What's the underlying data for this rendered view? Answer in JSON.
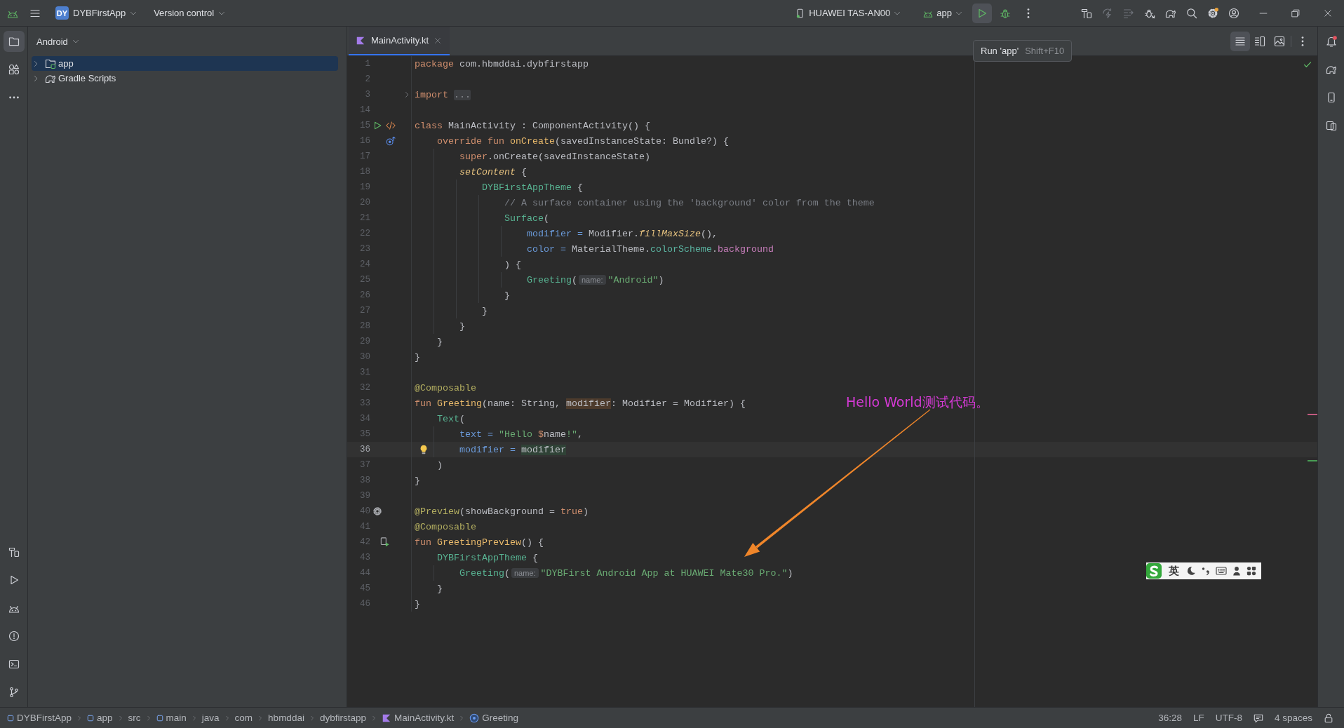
{
  "title_bar": {
    "project_badge": "DY",
    "project": "DYBFirstApp",
    "vcs": "Version control",
    "device": "HUAWEI TAS-AN00",
    "run_config": "app",
    "run_actions": [
      {
        "kind": "run",
        "hovered": true
      },
      {
        "kind": "debug",
        "hovered": false
      },
      {
        "kind": "more",
        "hovered": false
      }
    ],
    "tools": [
      {
        "kind": "make",
        "disabled": false,
        "badge": false
      },
      {
        "kind": "apply_changes",
        "disabled": true,
        "badge": false
      },
      {
        "kind": "apply_code_changes",
        "disabled": true,
        "badge": false
      },
      {
        "kind": "attach_debugger",
        "disabled": false,
        "badge": false
      },
      {
        "kind": "sync",
        "disabled": false,
        "badge": false
      },
      {
        "kind": "search",
        "disabled": false,
        "badge": false
      },
      {
        "kind": "settings",
        "disabled": false,
        "badge": true
      },
      {
        "kind": "account",
        "disabled": false,
        "badge": false
      }
    ],
    "window_controls": [
      {
        "kind": "minimize"
      },
      {
        "kind": "restore"
      },
      {
        "kind": "close"
      }
    ]
  },
  "tooltip": {
    "action": "Run 'app'",
    "shortcut": "Shift+F10"
  },
  "left_strip": {
    "top": [
      {
        "kind": "project",
        "selected": true
      },
      {
        "kind": "structure",
        "selected": false
      },
      {
        "kind": "more",
        "selected": false
      }
    ],
    "bottom": [
      {
        "kind": "build",
        "selected": false
      },
      {
        "kind": "run",
        "selected": false
      },
      {
        "kind": "app_quality",
        "selected": false
      },
      {
        "kind": "problems",
        "selected": false
      },
      {
        "kind": "terminal",
        "selected": false
      },
      {
        "kind": "git",
        "selected": false
      }
    ]
  },
  "project_panel": {
    "view": "Android",
    "tree": [
      {
        "label": "app",
        "kind": "module",
        "selected": true,
        "expanded": false
      },
      {
        "label": "Gradle Scripts",
        "kind": "gradle",
        "selected": false,
        "expanded": false
      }
    ]
  },
  "editor": {
    "tabs": [
      {
        "label": "MainActivity.kt",
        "kind": "kotlin",
        "selected": true
      }
    ],
    "view_modes": [
      {
        "kind": "code",
        "selected": true
      },
      {
        "kind": "split",
        "selected": false
      },
      {
        "kind": "design",
        "selected": false
      }
    ],
    "lines": [
      {
        "number": "1",
        "current": false,
        "tokens": [
          {
            "kind": "keyword",
            "text": "package"
          },
          {
            "kind": "plain",
            "text": " com.hbmddai.dybfirstapp"
          }
        ]
      },
      {
        "number": "2",
        "current": false
      },
      {
        "number": "3",
        "current": false,
        "markers": [
          {
            "kind": "fold"
          }
        ],
        "tokens": [
          {
            "kind": "keyword",
            "text": "import "
          },
          {
            "kind": "folded",
            "text": "..."
          }
        ]
      },
      {
        "number": "14",
        "current": false
      },
      {
        "number": "15",
        "current": false,
        "markers": [
          {
            "kind": "run"
          },
          {
            "kind": "compose"
          }
        ],
        "tokens": [
          {
            "kind": "keyword",
            "text": "class"
          },
          {
            "kind": "plain",
            "text": " MainActivity : ComponentActivity() {"
          }
        ]
      },
      {
        "number": "16",
        "current": false,
        "markers": [
          {
            "kind": "override"
          }
        ],
        "tokens": [
          {
            "kind": "keyword",
            "text": "    override fun "
          },
          {
            "kind": "declaration",
            "text": "onCreate"
          },
          {
            "kind": "plain",
            "text": "(savedInstanceState: Bundle?) {"
          }
        ]
      },
      {
        "number": "17",
        "current": false,
        "tokens": [
          {
            "kind": "keyword",
            "text": "        super"
          },
          {
            "kind": "plain",
            "text": ".onCreate(savedInstanceState)"
          }
        ]
      },
      {
        "number": "18",
        "current": false,
        "tokens": [
          {
            "kind": "extension",
            "text": "        setContent"
          },
          {
            "kind": "plain",
            "text": " {"
          }
        ]
      },
      {
        "number": "19",
        "current": false,
        "tokens": [
          {
            "kind": "composable",
            "text": "            DYBFirstAppTheme"
          },
          {
            "kind": "plain",
            "text": " {"
          }
        ]
      },
      {
        "number": "20",
        "current": false,
        "tokens": [
          {
            "kind": "comment",
            "text": "                // A surface container using the 'background' color from the theme"
          }
        ]
      },
      {
        "number": "21",
        "current": false,
        "tokens": [
          {
            "kind": "composable",
            "text": "                Surface"
          },
          {
            "kind": "plain",
            "text": "("
          }
        ]
      },
      {
        "number": "22",
        "current": false,
        "tokens": [
          {
            "kind": "named_arg",
            "text": "                    modifier ="
          },
          {
            "kind": "plain",
            "text": " Modifier."
          },
          {
            "kind": "extension",
            "text": "fillMaxSize"
          },
          {
            "kind": "plain",
            "text": "(),"
          }
        ]
      },
      {
        "number": "23",
        "current": false,
        "tokens": [
          {
            "kind": "named_arg",
            "text": "                    color ="
          },
          {
            "kind": "plain",
            "text": " MaterialTheme."
          },
          {
            "kind": "property",
            "text": "colorScheme"
          },
          {
            "kind": "plain",
            "text": "."
          },
          {
            "kind": "member",
            "text": "background"
          }
        ]
      },
      {
        "number": "24",
        "current": false,
        "tokens": [
          {
            "kind": "plain",
            "text": "                ) {"
          }
        ]
      },
      {
        "number": "25",
        "current": false,
        "tokens": [
          {
            "kind": "composable",
            "text": "                    Greeting"
          },
          {
            "kind": "plain",
            "text": "("
          },
          {
            "kind": "hint",
            "text": "name:"
          },
          {
            "kind": "string",
            "text": "\"Android\""
          },
          {
            "kind": "plain",
            "text": ")"
          }
        ]
      },
      {
        "number": "26",
        "current": false,
        "tokens": [
          {
            "kind": "plain",
            "text": "                }"
          }
        ]
      },
      {
        "number": "27",
        "current": false,
        "tokens": [
          {
            "kind": "plain",
            "text": "            }"
          }
        ]
      },
      {
        "number": "28",
        "current": false,
        "tokens": [
          {
            "kind": "plain",
            "text": "        }"
          }
        ]
      },
      {
        "number": "29",
        "current": false,
        "tokens": [
          {
            "kind": "plain",
            "text": "    }"
          }
        ]
      },
      {
        "number": "30",
        "current": false,
        "tokens": [
          {
            "kind": "plain",
            "text": "}"
          }
        ]
      },
      {
        "number": "31",
        "current": false
      },
      {
        "number": "32",
        "current": false,
        "tokens": [
          {
            "kind": "annotation",
            "text": "@Composable"
          }
        ]
      },
      {
        "number": "33",
        "current": false,
        "tokens": [
          {
            "kind": "keyword",
            "text": "fun "
          },
          {
            "kind": "declaration",
            "text": "Greeting"
          },
          {
            "kind": "plain",
            "text": "(name: String, "
          },
          {
            "kind": "write_usage",
            "text": "modifier"
          },
          {
            "kind": "plain",
            "text": ": Modifier = Modifier) {"
          }
        ]
      },
      {
        "number": "34",
        "current": false,
        "tokens": [
          {
            "kind": "composable",
            "text": "    Text"
          },
          {
            "kind": "plain",
            "text": "("
          }
        ]
      },
      {
        "number": "35",
        "current": false,
        "tokens": [
          {
            "kind": "named_arg",
            "text": "        text = "
          },
          {
            "kind": "string",
            "text": "\"Hello "
          },
          {
            "kind": "keyword",
            "text": "$"
          },
          {
            "kind": "plain",
            "text": "name"
          },
          {
            "kind": "string",
            "text": "!\""
          },
          {
            "kind": "plain",
            "text": ","
          }
        ]
      },
      {
        "number": "36",
        "current": true,
        "markers": [
          {
            "kind": "bulb"
          }
        ],
        "tokens": [
          {
            "kind": "named_arg",
            "text": "        modifier = "
          },
          {
            "kind": "read_usage",
            "text": "modifier"
          }
        ]
      },
      {
        "number": "37",
        "current": false,
        "tokens": [
          {
            "kind": "plain",
            "text": "    )"
          }
        ]
      },
      {
        "number": "38",
        "current": false,
        "tokens": [
          {
            "kind": "plain",
            "text": "}"
          }
        ]
      },
      {
        "number": "39",
        "current": false
      },
      {
        "number": "40",
        "current": false,
        "markers": [
          {
            "kind": "settings"
          }
        ],
        "tokens": [
          {
            "kind": "annotation",
            "text": "@Preview"
          },
          {
            "kind": "plain",
            "text": "(showBackground = "
          },
          {
            "kind": "keyword",
            "text": "true"
          },
          {
            "kind": "plain",
            "text": ")"
          }
        ]
      },
      {
        "number": "41",
        "current": false,
        "tokens": [
          {
            "kind": "annotation",
            "text": "@Composable"
          }
        ]
      },
      {
        "number": "42",
        "current": false,
        "markers": [
          {
            "kind": "preview"
          }
        ],
        "tokens": [
          {
            "kind": "keyword",
            "text": "fun "
          },
          {
            "kind": "declaration",
            "text": "GreetingPreview"
          },
          {
            "kind": "plain",
            "text": "() {"
          }
        ]
      },
      {
        "number": "43",
        "current": false,
        "tokens": [
          {
            "kind": "composable",
            "text": "    DYBFirstAppTheme"
          },
          {
            "kind": "plain",
            "text": " {"
          }
        ]
      },
      {
        "number": "44",
        "current": false,
        "tokens": [
          {
            "kind": "composable",
            "text": "        Greeting"
          },
          {
            "kind": "plain",
            "text": "("
          },
          {
            "kind": "hint",
            "text": "name:"
          },
          {
            "kind": "string",
            "text": "\"DYBFirst Android App at HUAWEI Mate30 Pro.\""
          },
          {
            "kind": "plain",
            "text": ")"
          }
        ]
      },
      {
        "number": "45",
        "current": false,
        "tokens": [
          {
            "kind": "plain",
            "text": "    }"
          }
        ]
      },
      {
        "number": "46",
        "current": false,
        "tokens": [
          {
            "kind": "plain",
            "text": "}"
          }
        ]
      }
    ]
  },
  "annotation": {
    "text": "Hello World测试代码。"
  },
  "right_strip": [
    {
      "kind": "notifications",
      "badge": true
    },
    {
      "kind": "gradle",
      "badge": false
    },
    {
      "kind": "device_manager",
      "badge": false
    },
    {
      "kind": "running_devices",
      "badge": false
    }
  ],
  "ime_toolbar": {
    "mode": "英"
  },
  "status_bar": {
    "breadcrumbs": [
      {
        "label": "DYBFirstApp",
        "kind": "module"
      },
      {
        "label": "app",
        "kind": "module"
      },
      {
        "label": "src",
        "kind": "plain"
      },
      {
        "label": "main",
        "kind": "module"
      },
      {
        "label": "java",
        "kind": "plain"
      },
      {
        "label": "com",
        "kind": "plain"
      },
      {
        "label": "hbmddai",
        "kind": "plain"
      },
      {
        "label": "dybfirstapp",
        "kind": "plain"
      },
      {
        "label": "MainActivity.kt",
        "kind": "kotlin"
      },
      {
        "label": "Greeting",
        "kind": "function"
      }
    ],
    "caret": "36:28",
    "line_separator": "LF",
    "encoding": "UTF-8",
    "indent": "4 spaces"
  }
}
